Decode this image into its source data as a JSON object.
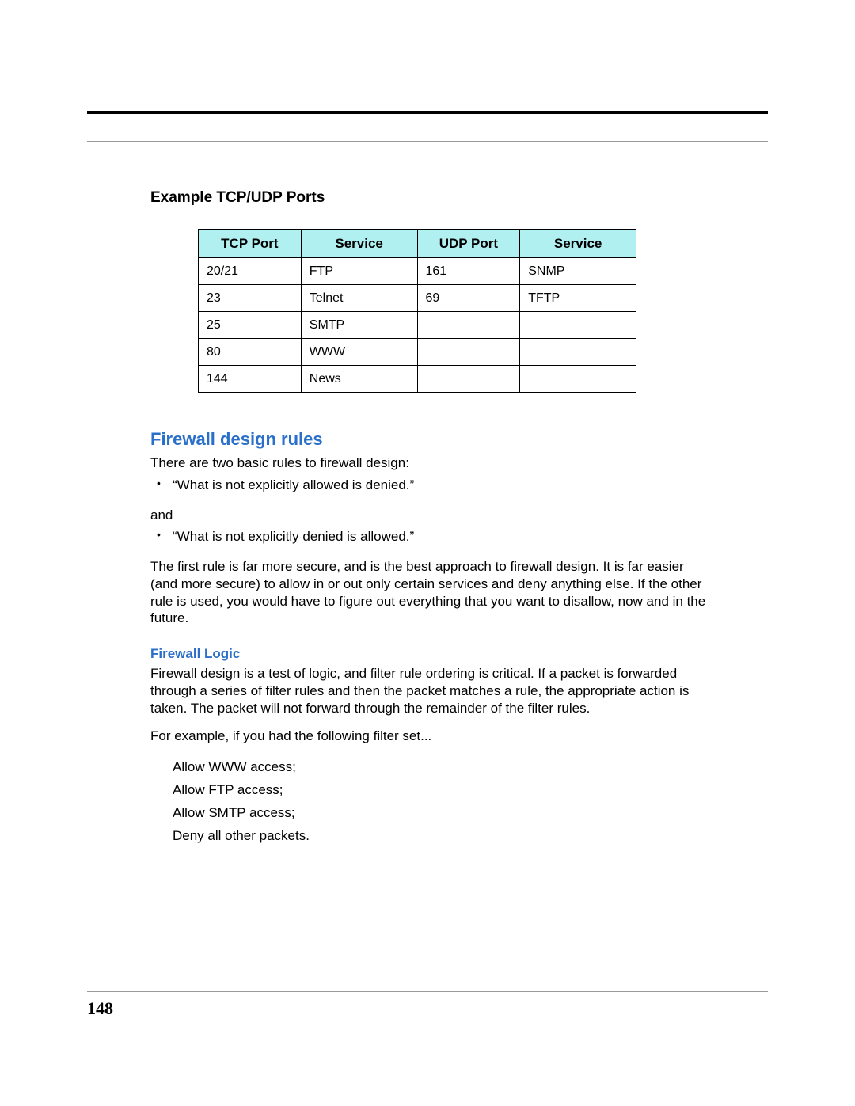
{
  "table_heading": "Example TCP/UDP Ports",
  "table": {
    "headers": [
      "TCP Port",
      "Service",
      "UDP Port",
      "Service"
    ],
    "rows": [
      {
        "tcp_port": "20/21",
        "tcp_service": "FTP",
        "udp_port": "161",
        "udp_service": "SNMP"
      },
      {
        "tcp_port": "23",
        "tcp_service": "Telnet",
        "udp_port": "69",
        "udp_service": "TFTP"
      },
      {
        "tcp_port": "25",
        "tcp_service": "SMTP",
        "udp_port": "",
        "udp_service": ""
      },
      {
        "tcp_port": "80",
        "tcp_service": "WWW",
        "udp_port": "",
        "udp_service": ""
      },
      {
        "tcp_port": "144",
        "tcp_service": "News",
        "udp_port": "",
        "udp_service": ""
      }
    ]
  },
  "section_title": "Firewall design rules",
  "intro": "There are two basic rules to firewall design:",
  "rule1": "“What is not explicitly allowed is denied.”",
  "and_word": "and",
  "rule2": "“What is not explicitly denied is allowed.”",
  "explanation": "The first rule is far more secure, and is the best approach to firewall design. It is far easier (and more secure) to allow in or out only certain services and deny anything else. If the other rule is used, you would have to figure out everything that you want to disallow, now and in the future.",
  "subsection_title": "Firewall Logic",
  "logic_para": "Firewall design is a test of logic, and filter rule ordering is critical. If a packet is forwarded through a series of filter rules and then the packet matches a rule, the appropriate action is taken. The packet will not forward through the remainder of the filter rules.",
  "example_intro": "For example, if you had the following filter set...",
  "filters": [
    "Allow WWW access;",
    "Allow FTP access;",
    "Allow SMTP access;",
    "Deny all other packets."
  ],
  "page_number": "148"
}
